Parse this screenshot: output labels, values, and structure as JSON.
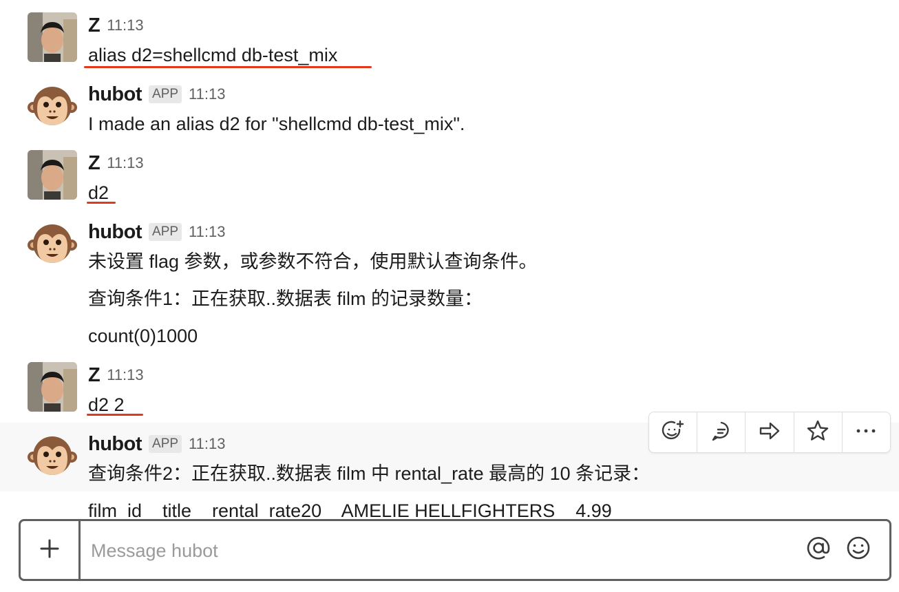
{
  "messages": [
    {
      "sender": "Z",
      "time": "11:13",
      "lines": [
        "alias d2=shellcmd db-test_mix"
      ]
    },
    {
      "sender": "hubot",
      "badge": "APP",
      "time": "11:13",
      "lines": [
        "I made an alias d2 for \"shellcmd db-test_mix\"."
      ]
    },
    {
      "sender": "Z",
      "time": "11:13",
      "lines": [
        "d2"
      ]
    },
    {
      "sender": "hubot",
      "badge": "APP",
      "time": "11:13",
      "lines": [
        "未设置 flag 参数，或参数不符合，使用默认查询条件。",
        "查询条件1：正在获取..数据表 film 的记录数量：",
        "count(0)1000"
      ]
    },
    {
      "sender": "Z",
      "time": "11:13",
      "lines": [
        "d2 2"
      ]
    },
    {
      "sender": "hubot",
      "badge": "APP",
      "time": "11:13",
      "lines": [
        "查询条件2：正在获取..数据表 film 中 rental_rate 最高的 10 条记录：",
        "film_id    title    rental_rate20    AMELIE HELLFIGHTERS    4.99"
      ]
    }
  ],
  "message_actions": [
    "add-reaction-icon",
    "start-thread-icon",
    "share-message-icon",
    "save-star-icon",
    "more-actions-icon"
  ],
  "composer": {
    "placeholder": "Message hubot"
  },
  "colors": {
    "annotation_underline": "#e2381c",
    "composer_border": "#616061",
    "hover_row": "#f8f8f8"
  }
}
